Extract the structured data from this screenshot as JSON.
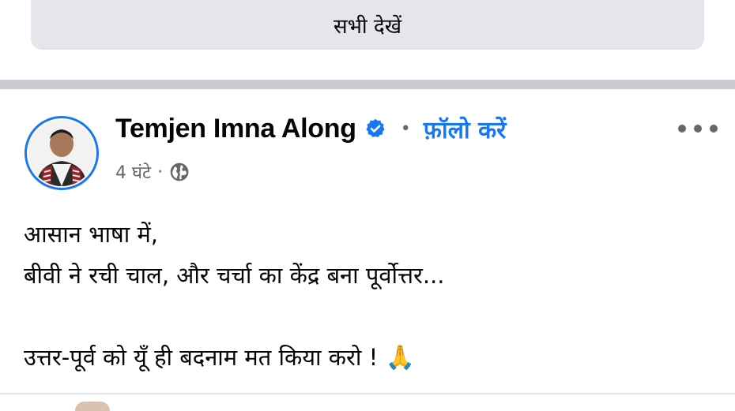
{
  "see_all": {
    "label": "सभी देखें"
  },
  "post": {
    "author": "Temjen Imna Along",
    "verified_icon": "verified-badge-icon",
    "separator": "•",
    "follow_label": "फ़ॉलो करें",
    "more_icon": "more-options-icon",
    "time": "4 घंटे",
    "meta_separator": "·",
    "privacy_icon": "globe-icon",
    "lines": [
      "आसान भाषा में,",
      "बीवी ने रची चाल, और चर्चा का केंद्र बना पूर्वोत्तर...",
      "",
      "उत्तर-पूर्व को यूँ ही बदनाम मत किया करो !"
    ],
    "emoji": "🙏"
  },
  "colors": {
    "accent": "#1877f2",
    "secondary_text": "#65676b",
    "divider": "#c9ccd1",
    "button_bg": "#e4e6eb"
  }
}
